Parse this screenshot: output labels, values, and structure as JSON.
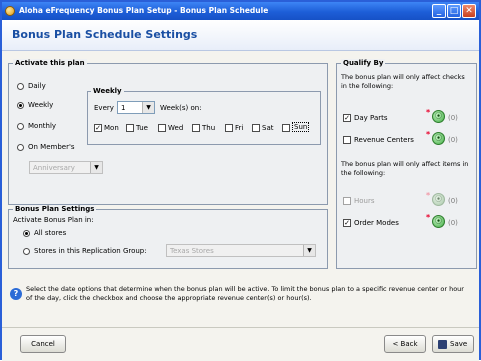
{
  "window": {
    "title": "Aloha eFrequency Bonus Plan Setup - Bonus Plan Schedule",
    "minimize_glyph": "_",
    "maximize_glyph": "□",
    "close_glyph": "✕"
  },
  "header": {
    "title": "Bonus Plan Schedule Settings"
  },
  "activate": {
    "legend": "Activate this plan",
    "options": [
      {
        "label": "Daily",
        "selected": false
      },
      {
        "label": "Weekly",
        "selected": true
      },
      {
        "label": "Monthly",
        "selected": false
      },
      {
        "label": "On Member's",
        "selected": false
      }
    ],
    "member_select": "Anniversary",
    "weekly": {
      "legend": "Weekly",
      "every_label": "Every",
      "every_value": "1",
      "weeks_label": "Week(s) on:",
      "days": [
        {
          "label": "Mon",
          "checked": true
        },
        {
          "label": "Tue",
          "checked": false
        },
        {
          "label": "Wed",
          "checked": false
        },
        {
          "label": "Thu",
          "checked": false
        },
        {
          "label": "Fri",
          "checked": false
        },
        {
          "label": "Sat",
          "checked": false
        },
        {
          "label": "Sun",
          "checked": false
        }
      ]
    }
  },
  "bonus_settings": {
    "legend": "Bonus Plan Settings",
    "activate_label": "Activate Bonus Plan in:",
    "all_stores": "All stores",
    "group_label": "Stores in this Replication Group:",
    "group_value": "Texas Stores"
  },
  "qualify": {
    "legend": "Qualify By",
    "checks_text": "The bonus plan will only affect checks in the following:",
    "items_text": "The bonus plan will only affect items in the following:",
    "day_parts": {
      "label": "Day Parts",
      "count": "(0)"
    },
    "revenue_centers": {
      "label": "Revenue Centers",
      "count": "(0)"
    },
    "hours": {
      "label": "Hours",
      "count": "(0)"
    },
    "order_modes": {
      "label": "Order Modes",
      "count": "(0)"
    }
  },
  "info": {
    "text": "Select the date options that determine when the bonus plan will be active.  To limit the bonus plan to a specific revenue center or hour of the day, click the checkbox and choose the appropriate revenue center(s) or hour(s)."
  },
  "buttons": {
    "cancel": "Cancel",
    "back": "< Back",
    "save": "Save"
  },
  "colors": {
    "title_bar": "#1d5ed8",
    "header_text": "#1a4fa3",
    "required_star": "#e8002c"
  }
}
